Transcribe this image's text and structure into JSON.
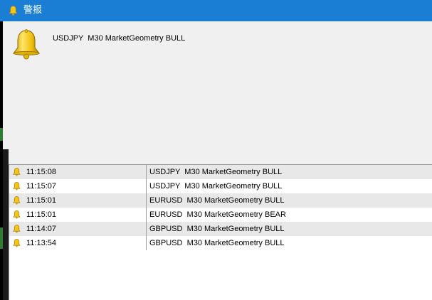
{
  "window": {
    "title": "警报",
    "title_icon": "bell-icon",
    "accent_color": "#1a7fd4"
  },
  "current_alert": {
    "icon": "bell-icon",
    "message": "USDJPY  M30 MarketGeometry BULL"
  },
  "alert_history": [
    {
      "time": "11:15:08",
      "message": "USDJPY  M30 MarketGeometry BULL"
    },
    {
      "time": "11:15:07",
      "message": "USDJPY  M30 MarketGeometry BULL"
    },
    {
      "time": "11:15:01",
      "message": "EURUSD  M30 MarketGeometry BULL"
    },
    {
      "time": "11:15:01",
      "message": "EURUSD  M30 MarketGeometry BEAR"
    },
    {
      "time": "11:14:07",
      "message": "GBPUSD  M30 MarketGeometry BULL"
    },
    {
      "time": "11:13:54",
      "message": "GBPUSD  M30 MarketGeometry BULL"
    }
  ]
}
